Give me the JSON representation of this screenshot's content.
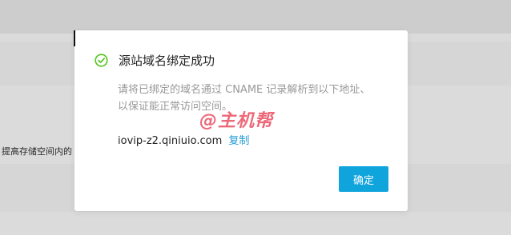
{
  "background": {
    "truncated_text": "提高存储空间内的"
  },
  "modal": {
    "title": "源站域名绑定成功",
    "description": "请将已绑定的域名通过 CNAME 记录解析到以下地址、以保证能正常访问空间。",
    "cname_domain": "iovip-z2.qiniuio.com",
    "copy_label": "复制",
    "confirm_label": "确定",
    "icon": "check-circle-icon",
    "watermark_text": "@主机帮"
  },
  "colors": {
    "success": "#52c41a",
    "link": "#1f9ad6",
    "primary_button": "#10a4dd",
    "watermark": "#e8485c"
  }
}
